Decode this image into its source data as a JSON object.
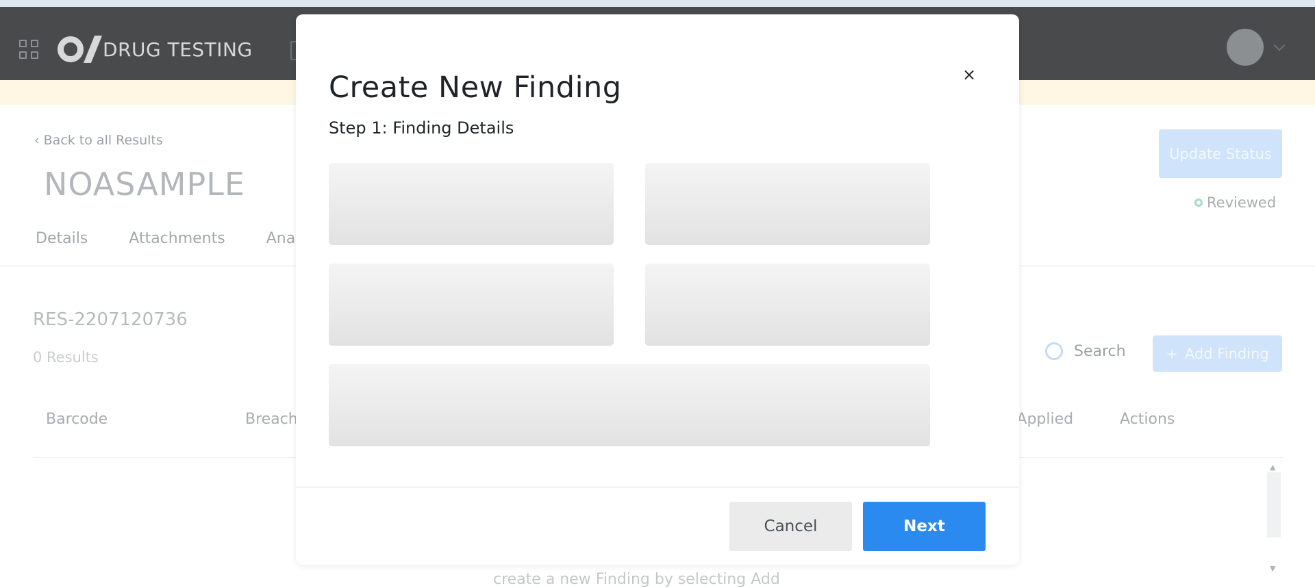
{
  "app": {
    "brand": "DRUG TESTING"
  },
  "page": {
    "back_link": "Back to all Results",
    "sample_title": "NOASAMPLE",
    "tabs": [
      "Details",
      "Attachments",
      "Ana"
    ],
    "update_status_label": "Update Status",
    "status_text": "Reviewed"
  },
  "results": {
    "id": "RES-2207120736",
    "count_text": "0 Results",
    "search_label": "Search",
    "add_finding_label": "Add Finding",
    "columns": [
      "Barcode",
      "Breach",
      "ns Applied",
      "Actions"
    ],
    "empty_text": "create a new Finding by selecting Add"
  },
  "modal": {
    "title": "Create New Finding",
    "step_label": "Step 1: Finding Details",
    "close_symbol": "×",
    "cancel_label": "Cancel",
    "next_label": "Next",
    "fields_loading": [
      true,
      true,
      true,
      true,
      true
    ]
  },
  "colors": {
    "primary": "#2a8af0",
    "navbar": "#484a4c",
    "banner": "#fff6e3"
  }
}
